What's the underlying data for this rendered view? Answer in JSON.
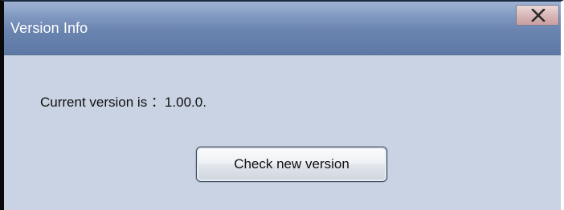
{
  "window": {
    "title": "Version Info",
    "close_icon": "close-x-icon"
  },
  "content": {
    "version_text": "Current version is ：1.00.0."
  },
  "buttons": {
    "check_label": "Check new version"
  },
  "colors": {
    "titlebar": "#6a84b0",
    "client_bg": "#c9d3e3",
    "close_button": "#d9b8b8",
    "text": "#101010"
  }
}
